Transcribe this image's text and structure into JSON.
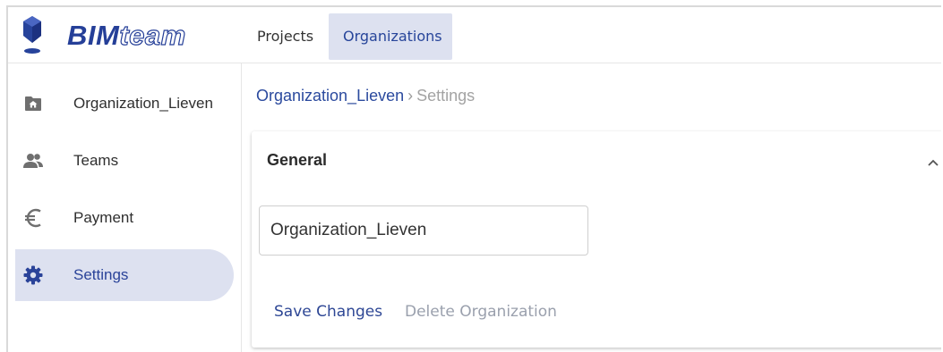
{
  "brand": {
    "bim": "BIM",
    "team": "team",
    "accent": "#253f98"
  },
  "topnav": {
    "tabs": [
      {
        "label": "Projects",
        "active": false
      },
      {
        "label": "Organizations",
        "active": true
      }
    ],
    "active_color": "#dde1f0"
  },
  "sidebar": {
    "items": [
      {
        "label": "Organization_Lieven",
        "icon": "folder-home-icon",
        "active": false
      },
      {
        "label": "Teams",
        "icon": "people-icon",
        "active": false
      },
      {
        "label": "Payment",
        "icon": "euro-icon",
        "active": false
      },
      {
        "label": "Settings",
        "icon": "gear-icon",
        "active": true
      }
    ]
  },
  "breadcrumb": {
    "parent": "Organization_Lieven",
    "separator": "›",
    "current": "Settings"
  },
  "general_panel": {
    "title": "General",
    "expanded": true,
    "collapse_icon": "chevron-up-icon",
    "name_field": {
      "value": "Organization_Lieven"
    },
    "save_label": "Save Changes",
    "delete_label": "Delete Organization"
  }
}
